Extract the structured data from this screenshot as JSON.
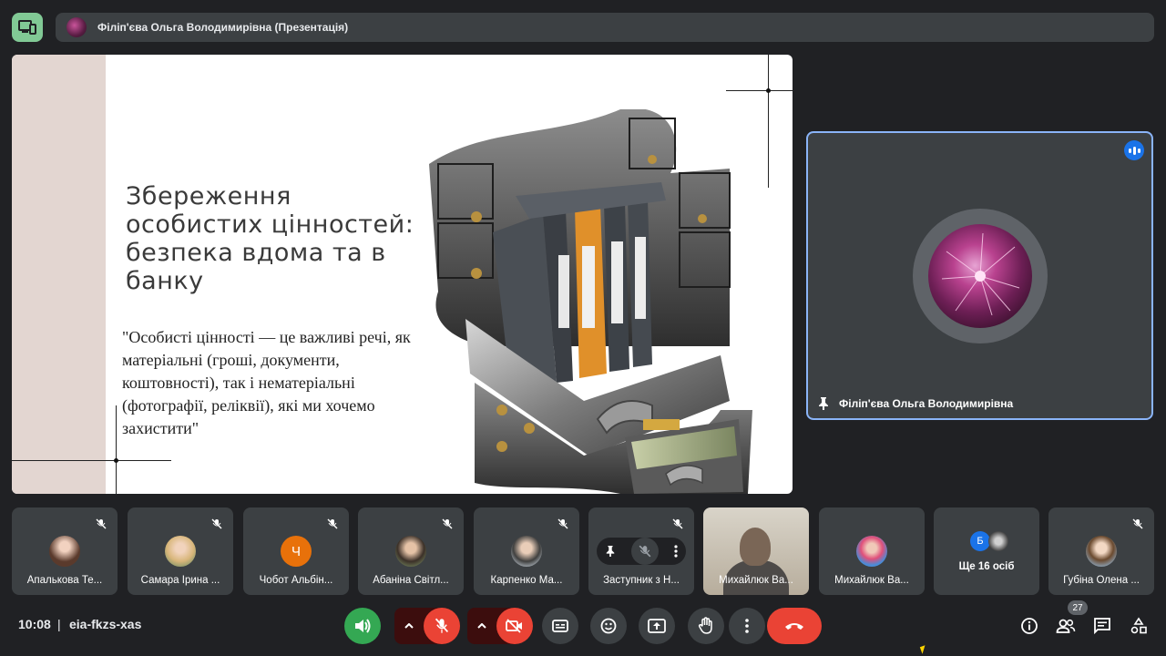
{
  "top_bar": {
    "layout_icon": "monitor-phone-icon",
    "presenter_label": "Філіп'єва Ольга Володимирівна (Презентація)"
  },
  "slide": {
    "title": "Збереження особистих цінностей: безпека вдома та в банку",
    "quote": "\"Особисті цінності — це важливі речі, як матеріальні (гроші, документи, коштовності), так і нематеріальні (фотографії, реліквії), які ми хочемо захистити\"",
    "image": "safe-deposit-boxes-with-binders-and-money-illustration",
    "band_color": "#e3d6d1"
  },
  "main_participant": {
    "name": "Філіп'єва Ольга Володимирівна",
    "pin_icon": "pin-icon",
    "speaking_icon": "speaking-indicator-icon",
    "highlight_color": "#8ab4f8"
  },
  "thumbnails": [
    {
      "name": "Апалькова Те...",
      "muted": true,
      "avatar_color": "#c9a98f"
    },
    {
      "name": "Самара Ірина ...",
      "muted": true,
      "avatar_color": "#d8b67a"
    },
    {
      "name": "Чобот Альбін...",
      "muted": true,
      "initial": "Ч",
      "avatar_color": "#e8710a"
    },
    {
      "name": "Абаніна Світл...",
      "muted": true,
      "avatar_color": "#7d6a5a"
    },
    {
      "name": "Карпенко Ма...",
      "muted": true,
      "avatar_color": "#9aa7b4"
    },
    {
      "name": "Заступник з Н...",
      "muted": true,
      "hover_controls": true
    },
    {
      "name": "Михайлюк Ва...",
      "video": true
    },
    {
      "name": "Михайлюк Ва...",
      "avatar_color": "#4a8bd6"
    },
    {
      "name": "Ще 16 осіб",
      "more": true,
      "initial": "Б"
    },
    {
      "name": "Губіна Олена ...",
      "muted": true,
      "avatar_color": "#8ba3b8"
    }
  ],
  "bottom_bar": {
    "time": "10:08",
    "separator": "|",
    "meeting_code": "eia-fkzs-xas",
    "participants_count": "27",
    "colors": {
      "speaker_on": "#34a853",
      "off_red": "#ea4335",
      "bar_bg": "#3c4043"
    }
  }
}
